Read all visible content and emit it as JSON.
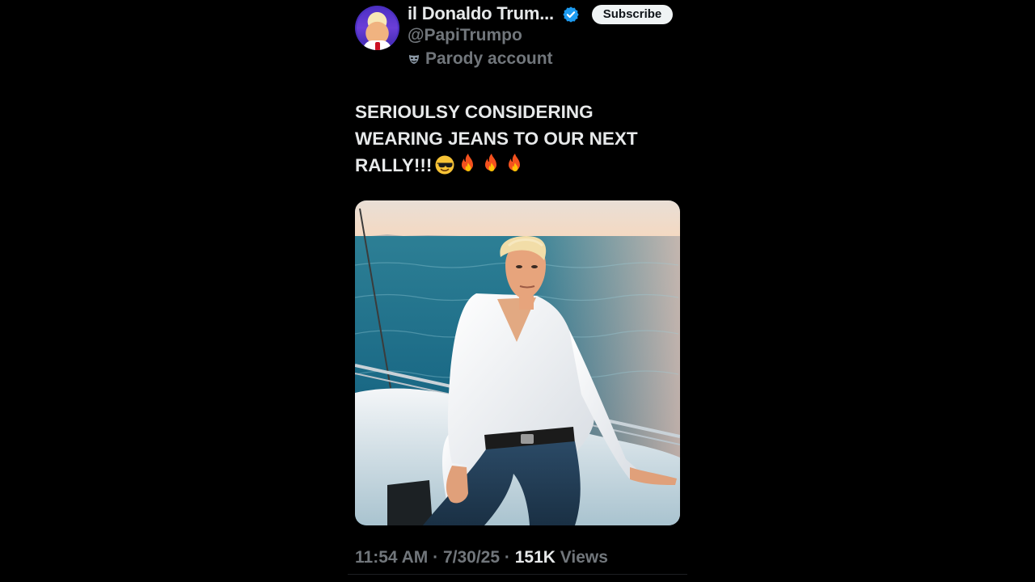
{
  "post": {
    "author": {
      "display_name": "il Donaldo Trum...",
      "handle": "@PapiTrumpo",
      "label": "Parody account",
      "label_icon": "parody-mask-icon",
      "verified_icon": "verified-badge-icon"
    },
    "subscribe_label": "Subscribe",
    "text_lines": [
      "SERIOULSY CONSIDERING",
      "WEARING JEANS TO OUR NEXT",
      "RALLY!!!"
    ],
    "emojis": [
      "smiling-face-with-sunglasses-icon",
      "fire-icon",
      "fire-icon",
      "fire-icon"
    ],
    "media_alt_icon": "photo-yacht",
    "time": "11:54 AM",
    "separator": "·",
    "date": "7/30/25",
    "views_count": "151K",
    "views_label": "Views"
  },
  "colors": {
    "background": "#000000",
    "primary_text": "#e7e9ea",
    "secondary_text": "#71767b",
    "verified_blue": "#1d9bf0",
    "button_bg": "#eff3f4"
  }
}
